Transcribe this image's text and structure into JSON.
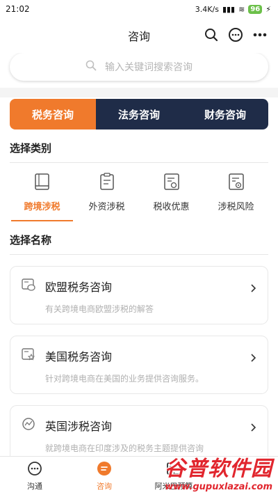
{
  "status_bar": {
    "time": "21:02",
    "network": "3.4K/s",
    "battery": "96"
  },
  "header": {
    "title": "咨询"
  },
  "search": {
    "placeholder": "输入关键词搜索咨询"
  },
  "tabs": [
    {
      "label": "税务咨询"
    },
    {
      "label": "法务咨询"
    },
    {
      "label": "财务咨询"
    }
  ],
  "category_section": {
    "title": "选择类别"
  },
  "categories": [
    {
      "label": "跨境涉税",
      "icon": "book-icon"
    },
    {
      "label": "外资涉税",
      "icon": "clipboard-icon"
    },
    {
      "label": "税收优惠",
      "icon": "discount-doc-icon"
    },
    {
      "label": "涉税风险",
      "icon": "risk-doc-icon"
    }
  ],
  "name_section": {
    "title": "选择名称"
  },
  "items": [
    {
      "name": "欧盟税务咨询",
      "desc": "有关跨境电商欧盟涉税的解答",
      "icon": "chat-card-icon"
    },
    {
      "name": "美国税务咨询",
      "desc": "针对跨境电商在美国的业务提供咨询服务。",
      "icon": "star-card-icon"
    },
    {
      "name": "英国涉税咨询",
      "desc": "就跨境电商在印度涉及的税务主题提供咨询",
      "icon": "refresh-circle-icon"
    }
  ],
  "bottom_nav": [
    {
      "label": "沟通",
      "icon": "chat-bubble-icon"
    },
    {
      "label": "咨询",
      "icon": "consult-icon"
    },
    {
      "label": "阿米巴预算",
      "icon": "book-open-icon"
    }
  ],
  "watermark": {
    "line1": "谷普软件园",
    "line2": "www.gupuxlazai.com"
  },
  "colors": {
    "accent": "#f07a2c",
    "dark_tab": "#1f2c48"
  }
}
